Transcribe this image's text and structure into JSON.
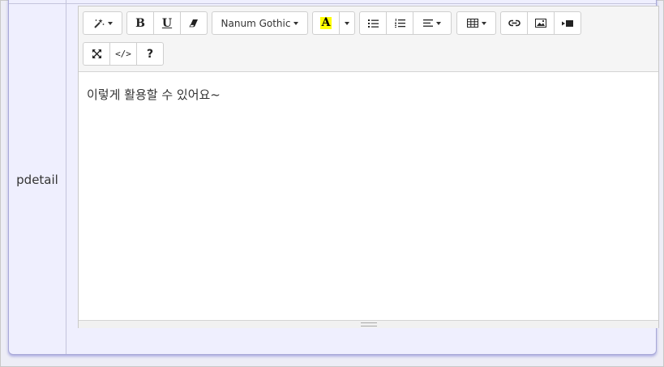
{
  "field": {
    "label": "pdetail"
  },
  "toolbar": {
    "style_icon": "magic-wand-icon",
    "bold_label": "B",
    "underline_label": "U",
    "clear_format_icon": "eraser-icon",
    "font_name": "Nanum Gothic",
    "text_color_label": "A",
    "text_color_highlight": "#ffff00",
    "unordered_list_icon": "bullet-list-icon",
    "ordered_list_icon": "numbered-list-icon",
    "paragraph_align_icon": "align-left-icon",
    "table_icon": "table-icon",
    "link_icon": "link-icon",
    "picture_icon": "image-icon",
    "video_icon": "video-icon",
    "fullscreen_icon": "expand-icon",
    "codeview_label": "</>",
    "help_label": "?"
  },
  "editor": {
    "content": "이렇게 활용할 수 있어요~"
  },
  "colors": {
    "panel_background": "#efeffe",
    "panel_border": "#a9a9d8",
    "toolbar_background": "#f5f5f5"
  }
}
